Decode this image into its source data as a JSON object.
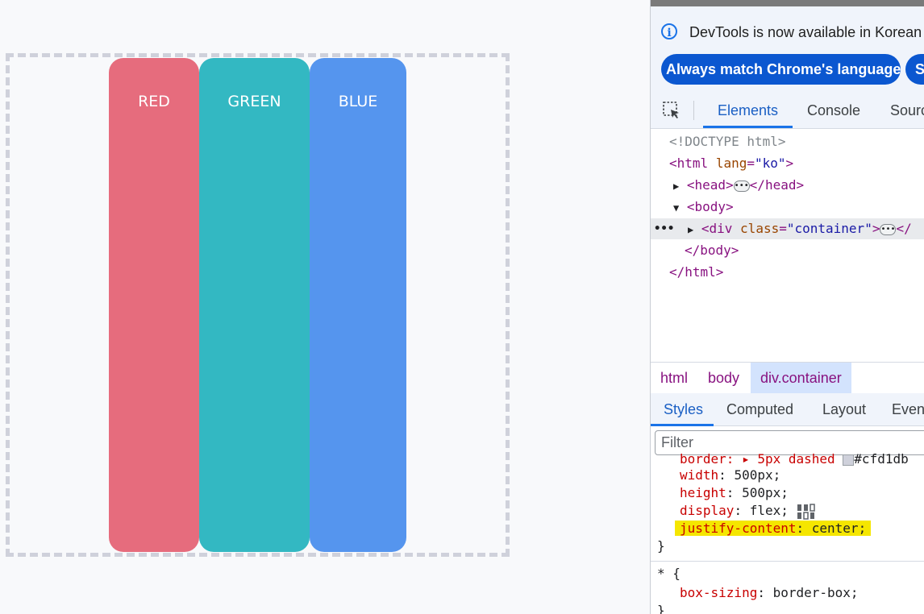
{
  "demo": {
    "bars": [
      {
        "label": "RED",
        "color": "#e66c7d"
      },
      {
        "label": "GREEN",
        "color": "#33b8c2"
      },
      {
        "label": "BLUE",
        "color": "#5595ee"
      }
    ]
  },
  "devtools": {
    "info": {
      "message": "DevTools is now available in Korean",
      "primary_button": "Always match Chrome's language",
      "secondary_button": "Switch"
    },
    "tabs": [
      "Elements",
      "Console",
      "Sources"
    ],
    "dom": {
      "doctype": "<!DOCTYPE html>",
      "html_open_tag": "<html",
      "html_attr": "lang",
      "html_attr_val": "\"ko\"",
      "html_close_bracket": ">",
      "head_open": "<head>",
      "head_close": "</head>",
      "body_open": "<body>",
      "div_open": "<div",
      "div_attr": "class",
      "div_attr_val": "\"container\"",
      "div_close_bracket": ">",
      "div_tail": "</",
      "body_close": "</body>",
      "html_close": "</html>"
    },
    "breadcrumbs": [
      "html",
      "body",
      "div.container"
    ],
    "subtabs": [
      "Styles",
      "Computed",
      "Layout",
      "Event Listeners"
    ],
    "filter_placeholder": "Filter",
    "styles": {
      "partial_line": "border: ▸ 5px dashed ",
      "partial_color": "#cfd1db",
      "decls": [
        {
          "prop": "width",
          "value": "500px"
        },
        {
          "prop": "height",
          "value": "500px"
        },
        {
          "prop": "display",
          "value": "flex"
        },
        {
          "prop": "justify-content",
          "value": "center"
        }
      ],
      "close_brace": "}",
      "selector2": "* {",
      "decl2": {
        "prop": "box-sizing",
        "value": "border-box"
      },
      "close_brace2": "}"
    }
  }
}
